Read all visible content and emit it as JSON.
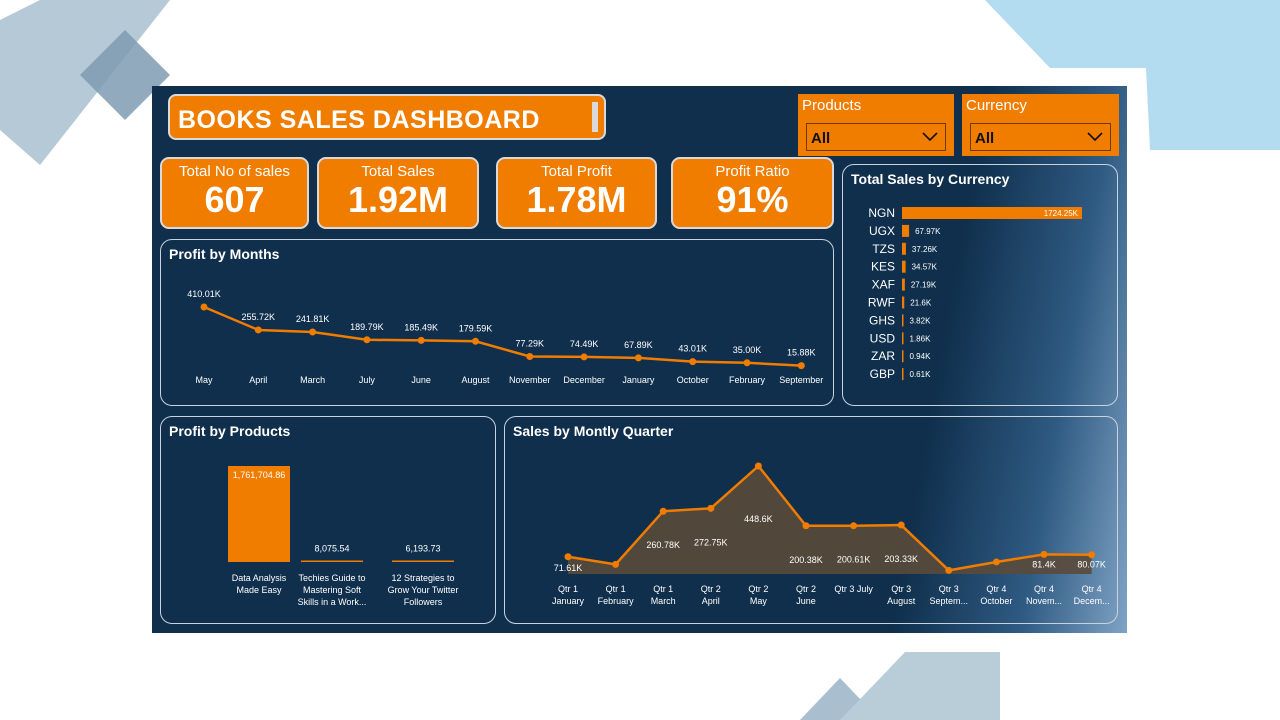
{
  "dashboard": {
    "title": "BOOKS SALES DASHBOARD"
  },
  "slicers": {
    "products": {
      "label": "Products",
      "value": "All"
    },
    "currency": {
      "label": "Currency",
      "value": "All"
    }
  },
  "kpis": [
    {
      "label": "Total No of sales",
      "value": "607"
    },
    {
      "label": "Total Sales",
      "value": "1.92M"
    },
    {
      "label": "Total Profit",
      "value": "1.78M"
    },
    {
      "label": "Profit Ratio",
      "value": "91%"
    }
  ],
  "colors": {
    "accent": "#f07c00",
    "background": "#0f2f4c",
    "area_fill": "#5a4a3a"
  },
  "chart_data": [
    {
      "id": "profit_by_months",
      "type": "line",
      "title": "Profit by Months",
      "categories": [
        "May",
        "April",
        "March",
        "July",
        "June",
        "August",
        "November",
        "December",
        "January",
        "October",
        "February",
        "September"
      ],
      "values": [
        410.01,
        255.72,
        241.81,
        189.79,
        185.49,
        179.59,
        77.29,
        74.49,
        67.89,
        43.01,
        35.0,
        15.88
      ],
      "labels": [
        "410.01K",
        "255.72K",
        "241.81K",
        "189.79K",
        "185.49K",
        "179.59K",
        "77.29K",
        "74.49K",
        "67.89K",
        "43.01K",
        "35.00K",
        "15.88K"
      ],
      "unit": "K",
      "ylim": [
        0,
        420
      ],
      "grid": false
    },
    {
      "id": "sales_by_currency",
      "type": "bar",
      "orientation": "horizontal",
      "title": "Total Sales by Currency",
      "categories": [
        "NGN",
        "UGX",
        "TZS",
        "KES",
        "XAF",
        "RWF",
        "GHS",
        "USD",
        "ZAR",
        "GBP"
      ],
      "values": [
        1724.25,
        67.97,
        37.26,
        34.57,
        27.19,
        21.6,
        3.82,
        1.86,
        0.94,
        0.61
      ],
      "labels": [
        "1724.25K",
        "67.97K",
        "37.26K",
        "34.57K",
        "27.19K",
        "21.6K",
        "3.82K",
        "1.86K",
        "0.94K",
        "0.61K"
      ],
      "unit": "K",
      "xlim": [
        0,
        1724.25
      ]
    },
    {
      "id": "profit_by_products",
      "type": "bar",
      "title": "Profit by Products",
      "categories": [
        [
          "Data Analysis",
          "Made Easy"
        ],
        [
          "Techies Guide to",
          "Mastering Soft",
          "Skills in a Work..."
        ],
        [
          "12 Strategies to",
          "Grow Your Twitter",
          "Followers"
        ]
      ],
      "values": [
        1761704.86,
        8075.54,
        6193.73
      ],
      "labels": [
        "1,761,704.86",
        "8,075.54",
        "6,193.73"
      ],
      "ylim": [
        0,
        1761704.86
      ]
    },
    {
      "id": "sales_by_quarter",
      "type": "area",
      "title": "Sales by Montly Quarter",
      "categories": [
        [
          "Qtr 1",
          "January"
        ],
        [
          "Qtr 1",
          "February"
        ],
        [
          "Qtr 1",
          "March"
        ],
        [
          "Qtr 2",
          "April"
        ],
        [
          "Qtr 2",
          "May"
        ],
        [
          "Qtr 2",
          "June"
        ],
        [
          "Qtr 3 July"
        ],
        [
          "Qtr 3",
          "August"
        ],
        [
          "Qtr 3",
          "Septem..."
        ],
        [
          "Qtr 4",
          "October"
        ],
        [
          "Qtr 4",
          "Novem..."
        ],
        [
          "Qtr 4",
          "Decem..."
        ]
      ],
      "values": [
        71.61,
        40,
        260.78,
        272.75,
        448.6,
        200.38,
        200.61,
        203.33,
        15,
        50,
        81.4,
        80.07
      ],
      "labels": [
        "71.61K",
        "",
        "260.78K",
        "272.75K",
        "448.6K",
        "200.38K",
        "200.61K",
        "203.33K",
        "",
        "",
        "81.4K",
        "80.07K"
      ],
      "unit": "K",
      "ylim": [
        0,
        460
      ]
    }
  ]
}
